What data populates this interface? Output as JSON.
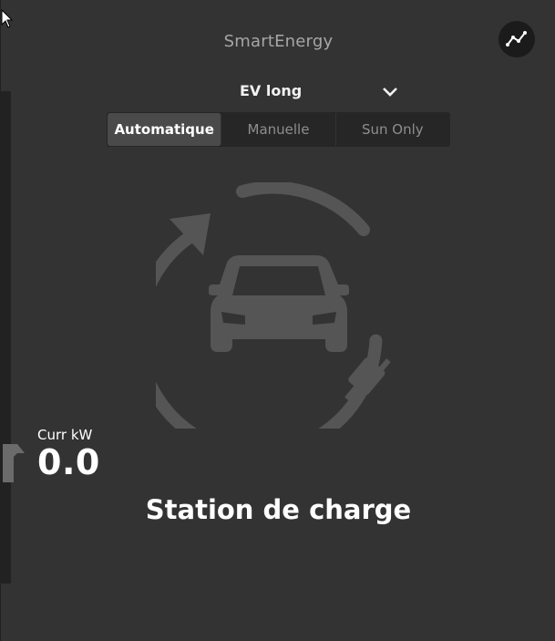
{
  "header": {
    "app_title": "SmartEnergy",
    "graph_button_icon": "line-chart-icon"
  },
  "device_selector": {
    "selected": "EV long",
    "icon": "chevron-down-icon"
  },
  "modes": {
    "items": [
      {
        "label": "Automatique",
        "active": true
      },
      {
        "label": "Manuelle",
        "active": false
      },
      {
        "label": "Sun Only",
        "active": false
      }
    ]
  },
  "status": {
    "main_icon": "ev-charging-icon",
    "current_label": "Curr kW",
    "current_value": "0.0",
    "device_name": "Station de charge"
  },
  "colors": {
    "panel_bg": "#333333",
    "icon_gray": "#555555",
    "text_primary": "#ffffff",
    "text_muted": "#a6a6a6",
    "active_mode_bg": "#4a4a4a"
  }
}
